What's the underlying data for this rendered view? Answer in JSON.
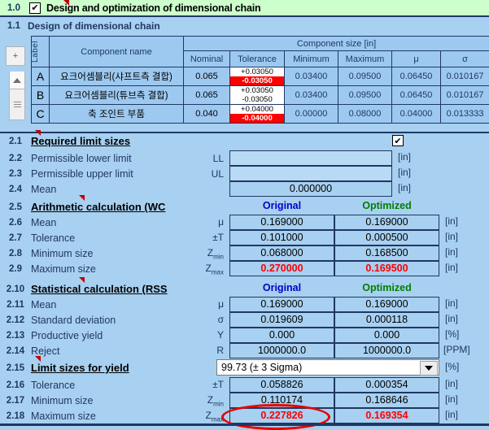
{
  "app": {
    "colors": {
      "sheet_bg": "#A8D0F0",
      "band_green": "#CCFFCC",
      "table_cell": "#9DC9F0",
      "field_bg": "#A8D0F0",
      "text": "#1F3864",
      "alert_red": "#FF0000",
      "original_blue": "#0000CC",
      "optimized_green": "#008000"
    }
  },
  "header": {
    "row_number": "1.0",
    "title": "Design and optimization of dimensional chain",
    "checkbox": "checked",
    "check_glyph": "✔"
  },
  "subheader": {
    "row_number": "1.1",
    "title": "Design of dimensional chain"
  },
  "gutter": {
    "add_button": "+",
    "scroll_up": "scroll-up",
    "scroll_thumb": "scroll-thumb"
  },
  "component_table": {
    "group_header": "Component size [in]",
    "label_header": "Label",
    "name_header": "Component name",
    "columns": [
      "Nominal",
      "Tolerance",
      "Minimum",
      "Maximum",
      "μ",
      "σ"
    ],
    "rows": [
      {
        "label": "A",
        "name": "요크어셈블리(샤프트측 결합)",
        "nominal": "0.065",
        "tol_upper": "+0.03050",
        "tol_lower": "-0.03050",
        "tol_upper_flag": "normal",
        "tol_lower_flag": "highlight",
        "minimum": "0.03400",
        "maximum": "0.09500",
        "mu": "0.06450",
        "sigma": "0.010167"
      },
      {
        "label": "B",
        "name": "요크어셈블리(튜브측 결합)",
        "nominal": "0.065",
        "tol_upper": "+0.03050",
        "tol_lower": "-0.03050",
        "tol_upper_flag": "normal",
        "tol_lower_flag": "normal",
        "minimum": "0.03400",
        "maximum": "0.09500",
        "mu": "0.06450",
        "sigma": "0.010167"
      },
      {
        "label": "C",
        "name": "축 조인트 부품",
        "nominal": "0.040",
        "tol_upper": "+0.04000",
        "tol_lower": "-0.04000",
        "tol_upper_flag": "normal",
        "tol_lower_flag": "highlight",
        "minimum": "0.00000",
        "maximum": "0.08000",
        "mu": "0.04000",
        "sigma": "0.013333"
      }
    ]
  },
  "section_limits": {
    "heading_num": "2.1",
    "heading": "Required limit sizes",
    "heading_checkbox": "checked",
    "rows": [
      {
        "num": "2.2",
        "label": "Permissible lower limit",
        "symbol": "LL",
        "value": "",
        "unit": "[in]"
      },
      {
        "num": "2.3",
        "label": "Permissible upper limit",
        "symbol": "UL",
        "value": "",
        "unit": "[in]"
      },
      {
        "num": "2.4",
        "label": "Mean",
        "symbol": "",
        "value": "0.000000",
        "unit": "[in]"
      }
    ]
  },
  "section_arithmetic": {
    "heading_num": "2.5",
    "heading": "Arithmetic calculation (WC",
    "col_original": "Original",
    "col_optimized": "Optimized",
    "rows": [
      {
        "num": "2.6",
        "label": "Mean",
        "symbol": "μ",
        "sub": "",
        "original": "0.169000",
        "optimized": "0.169000",
        "unit": "[in]",
        "flag": "normal"
      },
      {
        "num": "2.7",
        "label": "Tolerance",
        "symbol": "±T",
        "sub": "",
        "original": "0.101000",
        "optimized": "0.000500",
        "unit": "[in]",
        "flag": "normal"
      },
      {
        "num": "2.8",
        "label": "Minimum size",
        "symbol": "Z",
        "sub": "min",
        "original": "0.068000",
        "optimized": "0.168500",
        "unit": "[in]",
        "flag": "normal"
      },
      {
        "num": "2.9",
        "label": "Maximum size",
        "symbol": "Z",
        "sub": "max",
        "original": "0.270000",
        "optimized": "0.169500",
        "unit": "[in]",
        "flag": "red"
      }
    ]
  },
  "section_statistical": {
    "heading_num": "2.10",
    "heading": "Statistical calculation (RSS",
    "col_original": "Original",
    "col_optimized": "Optimized",
    "rows": [
      {
        "num": "2.11",
        "label": "Mean",
        "symbol": "μ",
        "sub": "",
        "original": "0.169000",
        "optimized": "0.169000",
        "unit": "[in]",
        "flag": "normal"
      },
      {
        "num": "2.12",
        "label": "Standard deviation",
        "symbol": "σ",
        "sub": "",
        "original": "0.019609",
        "optimized": "0.000118",
        "unit": "[in]",
        "flag": "normal"
      },
      {
        "num": "2.13",
        "label": "Productive yield",
        "symbol": "Y",
        "sub": "",
        "original": "0.000",
        "optimized": "0.000",
        "unit": "[%]",
        "flag": "normal"
      },
      {
        "num": "2.14",
        "label": "Reject",
        "symbol": "R",
        "sub": "",
        "original": "1000000.0",
        "optimized": "1000000.0",
        "unit": "[PPM]",
        "flag": "normal"
      }
    ]
  },
  "section_yield": {
    "heading_num": "2.15",
    "heading": "Limit sizes for yield",
    "dropdown_value": "99.73  (± 3 Sigma)",
    "dropdown_unit": "[%]",
    "rows": [
      {
        "num": "2.16",
        "label": "Tolerance",
        "symbol": "±T",
        "sub": "",
        "original": "0.058826",
        "optimized": "0.000354",
        "unit": "[in]",
        "flag": "normal"
      },
      {
        "num": "2.17",
        "label": "Minimum size",
        "symbol": "Z",
        "sub": "min",
        "original": "0.110174",
        "optimized": "0.168646",
        "unit": "[in]",
        "flag": "normal"
      },
      {
        "num": "2.18",
        "label": "Maximum size",
        "symbol": "Z",
        "sub": "max",
        "original": "0.227826",
        "optimized": "0.169354",
        "unit": "[in]",
        "flag": "red"
      }
    ]
  },
  "annotation": {
    "highlight_target": "0.227826",
    "shape": "red-ellipse"
  }
}
